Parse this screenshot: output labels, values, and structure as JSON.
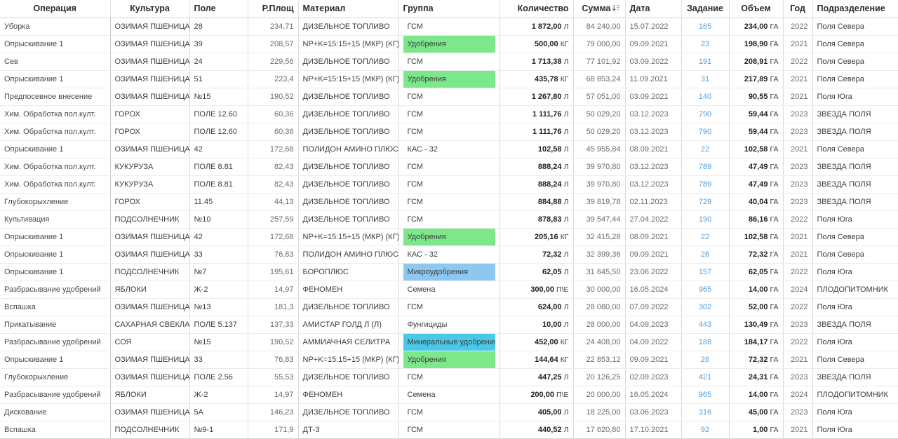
{
  "table": {
    "columns": [
      {
        "key": "operation",
        "label": "Операция",
        "align": "left"
      },
      {
        "key": "culture",
        "label": "Культура",
        "align": "left"
      },
      {
        "key": "field",
        "label": "Поле",
        "align": "left"
      },
      {
        "key": "area",
        "label": "Р.Площ",
        "align": "right"
      },
      {
        "key": "material",
        "label": "Материал",
        "align": "left"
      },
      {
        "key": "group",
        "label": "Группа",
        "align": "left"
      },
      {
        "key": "quantity",
        "label": "Количество",
        "align": "right"
      },
      {
        "key": "sum",
        "label": "Сумма",
        "align": "right",
        "sort": "desc",
        "sort_icon": "sort-descending-icon"
      },
      {
        "key": "date",
        "label": "Дата",
        "align": "left"
      },
      {
        "key": "task",
        "label": "Задание",
        "align": "center"
      },
      {
        "key": "volume",
        "label": "Объем",
        "align": "right"
      },
      {
        "key": "year",
        "label": "Год",
        "align": "right"
      },
      {
        "key": "division",
        "label": "Подразделение",
        "align": "left"
      }
    ],
    "group_colors": {
      "Удобрения": "#7ce88a",
      "Микроудобрения": "#8cc8f0",
      "Минеральные удобрения": "#49c9e8",
      "ГСМ": "",
      "КАС - 32": "",
      "Семена": "",
      "Фунгициды": ""
    },
    "rows": [
      {
        "operation": "Уборка",
        "culture": "ОЗИМАЯ ПШЕНИЦА",
        "field": "28",
        "area": "234,71",
        "material": "ДИЗЕЛЬНОЕ ТОПЛИВО",
        "group": "ГСМ",
        "quantity": "1 872,00",
        "unit": "Л",
        "sum": "84 240,00",
        "date": "15.07.2022",
        "task": "165",
        "volume": "234,00",
        "volume_unit": "ГА",
        "year": "2022",
        "division": "Поля Севера"
      },
      {
        "operation": "Опрыскивание 1",
        "culture": "ОЗИМАЯ ПШЕНИЦА",
        "field": "39",
        "area": "208,57",
        "material": "NP+K=15:15+15 (МКР) (КГ)",
        "group": "Удобрения",
        "quantity": "500,00",
        "unit": "КГ",
        "sum": "79 000,00",
        "date": "09.09.2021",
        "task": "23",
        "volume": "198,90",
        "volume_unit": "ГА",
        "year": "2021",
        "division": "Поля Севера"
      },
      {
        "operation": "Сев",
        "culture": "ОЗИМАЯ ПШЕНИЦА",
        "field": "24",
        "area": "229,56",
        "material": "ДИЗЕЛЬНОЕ ТОПЛИВО",
        "group": "ГСМ",
        "quantity": "1 713,38",
        "unit": "Л",
        "sum": "77 101,92",
        "date": "03.09.2022",
        "task": "191",
        "volume": "208,91",
        "volume_unit": "ГА",
        "year": "2022",
        "division": "Поля Севера"
      },
      {
        "operation": "Опрыскивание 1",
        "culture": "ОЗИМАЯ ПШЕНИЦА",
        "field": "51",
        "area": "223,4",
        "material": "NP+K=15:15+15 (МКР) (КГ)",
        "group": "Удобрения",
        "quantity": "435,78",
        "unit": "КГ",
        "sum": "68 853,24",
        "date": "11.09.2021",
        "task": "31",
        "volume": "217,89",
        "volume_unit": "ГА",
        "year": "2021",
        "division": "Поля Севера"
      },
      {
        "operation": "Предпосевное внесение",
        "culture": "ОЗИМАЯ ПШЕНИЦА",
        "field": "№15",
        "area": "190,52",
        "material": "ДИЗЕЛЬНОЕ ТОПЛИВО",
        "group": "ГСМ",
        "quantity": "1 267,80",
        "unit": "Л",
        "sum": "57 051,00",
        "date": "03.09.2021",
        "task": "140",
        "volume": "90,55",
        "volume_unit": "ГА",
        "year": "2021",
        "division": "Поля Юга"
      },
      {
        "operation": "Хим. Обработка пол.култ.",
        "culture": "ГОРОХ",
        "field": "ПОЛЕ 12.60",
        "area": "60,36",
        "material": "ДИЗЕЛЬНОЕ ТОПЛИВО",
        "group": "ГСМ",
        "quantity": "1 111,76",
        "unit": "Л",
        "sum": "50 029,20",
        "date": "03.12.2023",
        "task": "790",
        "volume": "59,44",
        "volume_unit": "ГА",
        "year": "2023",
        "division": "ЗВЕЗДА ПОЛЯ"
      },
      {
        "operation": "Хим. Обработка пол.култ.",
        "culture": "ГОРОХ",
        "field": "ПОЛЕ 12.60",
        "area": "60,36",
        "material": "ДИЗЕЛЬНОЕ ТОПЛИВО",
        "group": "ГСМ",
        "quantity": "1 111,76",
        "unit": "Л",
        "sum": "50 029,20",
        "date": "03.12.2023",
        "task": "790",
        "volume": "59,44",
        "volume_unit": "ГА",
        "year": "2023",
        "division": "ЗВЕЗДА ПОЛЯ"
      },
      {
        "operation": "Опрыскивание 1",
        "culture": "ОЗИМАЯ ПШЕНИЦА",
        "field": "42",
        "area": "172,68",
        "material": "ПОЛИДОН АМИНО ПЛЮС",
        "group": "КАС - 32",
        "quantity": "102,58",
        "unit": "Л",
        "sum": "45 955,84",
        "date": "08.09.2021",
        "task": "22",
        "volume": "102,58",
        "volume_unit": "ГА",
        "year": "2021",
        "division": "Поля Севера"
      },
      {
        "operation": "Хим. Обработка пол.култ.",
        "culture": "КУКУРУЗА",
        "field": "ПОЛЕ 8.81",
        "area": "82,43",
        "material": "ДИЗЕЛЬНОЕ ТОПЛИВО",
        "group": "ГСМ",
        "quantity": "888,24",
        "unit": "Л",
        "sum": "39 970,80",
        "date": "03.12.2023",
        "task": "789",
        "volume": "47,49",
        "volume_unit": "ГА",
        "year": "2023",
        "division": "ЗВЕЗДА ПОЛЯ"
      },
      {
        "operation": "Хим. Обработка пол.култ.",
        "culture": "КУКУРУЗА",
        "field": "ПОЛЕ 8.81",
        "area": "82,43",
        "material": "ДИЗЕЛЬНОЕ ТОПЛИВО",
        "group": "ГСМ",
        "quantity": "888,24",
        "unit": "Л",
        "sum": "39 970,80",
        "date": "03.12.2023",
        "task": "789",
        "volume": "47,49",
        "volume_unit": "ГА",
        "year": "2023",
        "division": "ЗВЕЗДА ПОЛЯ"
      },
      {
        "operation": "Глубокорыхление",
        "culture": "ГОРОХ",
        "field": "11.45",
        "area": "44,13",
        "material": "ДИЗЕЛЬНОЕ ТОПЛИВО",
        "group": "ГСМ",
        "quantity": "884,88",
        "unit": "Л",
        "sum": "39 819,78",
        "date": "02.11.2023",
        "task": "729",
        "volume": "40,04",
        "volume_unit": "ГА",
        "year": "2023",
        "division": "ЗВЕЗДА ПОЛЯ"
      },
      {
        "operation": "Культивация",
        "culture": "ПОДСОЛНЕЧНИК",
        "field": "№10",
        "area": "257,59",
        "material": "ДИЗЕЛЬНОЕ ТОПЛИВО",
        "group": "ГСМ",
        "quantity": "878,83",
        "unit": "Л",
        "sum": "39 547,44",
        "date": "27.04.2022",
        "task": "190",
        "volume": "86,16",
        "volume_unit": "ГА",
        "year": "2022",
        "division": "Поля Юга"
      },
      {
        "operation": "Опрыскивание 1",
        "culture": "ОЗИМАЯ ПШЕНИЦА",
        "field": "42",
        "area": "172,68",
        "material": "NP+K=15:15+15 (МКР) (КГ)",
        "group": "Удобрения",
        "quantity": "205,16",
        "unit": "КГ",
        "sum": "32 415,28",
        "date": "08.09.2021",
        "task": "22",
        "volume": "102,58",
        "volume_unit": "ГА",
        "year": "2021",
        "division": "Поля Севера"
      },
      {
        "operation": "Опрыскивание 1",
        "culture": "ОЗИМАЯ ПШЕНИЦА",
        "field": "33",
        "area": "76,83",
        "material": "ПОЛИДОН АМИНО ПЛЮС",
        "group": "КАС - 32",
        "quantity": "72,32",
        "unit": "Л",
        "sum": "32 399,36",
        "date": "09.09.2021",
        "task": "26",
        "volume": "72,32",
        "volume_unit": "ГА",
        "year": "2021",
        "division": "Поля Севера"
      },
      {
        "operation": "Опрыскивание 1",
        "culture": "ПОДСОЛНЕЧНИК",
        "field": "№7",
        "area": "195,61",
        "material": "БОРОПЛЮС",
        "group": "Микроудобрения",
        "quantity": "62,05",
        "unit": "Л",
        "sum": "31 645,50",
        "date": "23.06.2022",
        "task": "157",
        "volume": "62,05",
        "volume_unit": "ГА",
        "year": "2022",
        "division": "Поля Юга"
      },
      {
        "operation": "Разбрасывание удобрений",
        "culture": "ЯБЛОКИ",
        "field": "Ж-2",
        "area": "14,97",
        "material": "ФЕНОМЕН",
        "group": "Семена",
        "quantity": "300,00",
        "unit": "П\\Е",
        "sum": "30 000,00",
        "date": "16.05.2024",
        "task": "965",
        "volume": "14,00",
        "volume_unit": "ГА",
        "year": "2024",
        "division": "ПЛОДОПИТОМНИК"
      },
      {
        "operation": "Вспашка",
        "culture": "ОЗИМАЯ ПШЕНИЦА",
        "field": "№13",
        "area": "181,3",
        "material": "ДИЗЕЛЬНОЕ ТОПЛИВО",
        "group": "ГСМ",
        "quantity": "624,00",
        "unit": "Л",
        "sum": "28 080,00",
        "date": "07.09.2022",
        "task": "302",
        "volume": "52,00",
        "volume_unit": "ГА",
        "year": "2022",
        "division": "Поля Юга"
      },
      {
        "operation": "Прикатывание",
        "culture": "САХАРНАЯ СВЕКЛА",
        "field": "ПОЛЕ 5.137",
        "area": "137,33",
        "material": "АМИСТАР ГОЛД Л (Л)",
        "group": "Фунгициды",
        "quantity": "10,00",
        "unit": "Л",
        "sum": "28 000,00",
        "date": "04.09.2023",
        "task": "443",
        "volume": "130,49",
        "volume_unit": "ГА",
        "year": "2023",
        "division": "ЗВЕЗДА ПОЛЯ"
      },
      {
        "operation": "Разбрасывание удобрений",
        "culture": "СОЯ",
        "field": "№15",
        "area": "190,52",
        "material": "АММИАЧНАЯ СЕЛИТРА",
        "group": "Минеральные удобрения",
        "quantity": "452,00",
        "unit": "КГ",
        "sum": "24 408,00",
        "date": "04.09.2022",
        "task": "188",
        "volume": "184,17",
        "volume_unit": "ГА",
        "year": "2022",
        "division": "Поля Юга"
      },
      {
        "operation": "Опрыскивание 1",
        "culture": "ОЗИМАЯ ПШЕНИЦА",
        "field": "33",
        "area": "76,83",
        "material": "NP+K=15:15+15 (МКР) (КГ)",
        "group": "Удобрения",
        "quantity": "144,64",
        "unit": "КГ",
        "sum": "22 853,12",
        "date": "09.09.2021",
        "task": "26",
        "volume": "72,32",
        "volume_unit": "ГА",
        "year": "2021",
        "division": "Поля Севера"
      },
      {
        "operation": "Глубокорыхление",
        "culture": "ОЗИМАЯ ПШЕНИЦА",
        "field": "ПОЛЕ 2.56",
        "area": "55,53",
        "material": "ДИЗЕЛЬНОЕ ТОПЛИВО",
        "group": "ГСМ",
        "quantity": "447,25",
        "unit": "Л",
        "sum": "20 126,25",
        "date": "02.09.2023",
        "task": "421",
        "volume": "24,31",
        "volume_unit": "ГА",
        "year": "2023",
        "division": "ЗВЕЗДА ПОЛЯ"
      },
      {
        "operation": "Разбрасывание удобрений",
        "culture": "ЯБЛОКИ",
        "field": "Ж-2",
        "area": "14,97",
        "material": "ФЕНОМЕН",
        "group": "Семена",
        "quantity": "200,00",
        "unit": "П\\Е",
        "sum": "20 000,00",
        "date": "16.05.2024",
        "task": "965",
        "volume": "14,00",
        "volume_unit": "ГА",
        "year": "2024",
        "division": "ПЛОДОПИТОМНИК"
      },
      {
        "operation": "Дискование",
        "culture": "ОЗИМАЯ ПШЕНИЦА",
        "field": "5А",
        "area": "146,23",
        "material": "ДИЗЕЛЬНОЕ ТОПЛИВО",
        "group": "ГСМ",
        "quantity": "405,00",
        "unit": "Л",
        "sum": "18 225,00",
        "date": "03.06.2023",
        "task": "316",
        "volume": "45,00",
        "volume_unit": "ГА",
        "year": "2023",
        "division": "Поля Юга"
      },
      {
        "operation": "Вспашка",
        "culture": "ПОДСОЛНЕЧНИК",
        "field": "№9-1",
        "area": "171,9",
        "material": "ДТ-3",
        "group": "ГСМ",
        "quantity": "440,52",
        "unit": "Л",
        "sum": "17 620,80",
        "date": "17.10.2021",
        "task": "92",
        "volume": "1,00",
        "volume_unit": "ГА",
        "year": "2021",
        "division": "Поля Юга"
      }
    ]
  }
}
